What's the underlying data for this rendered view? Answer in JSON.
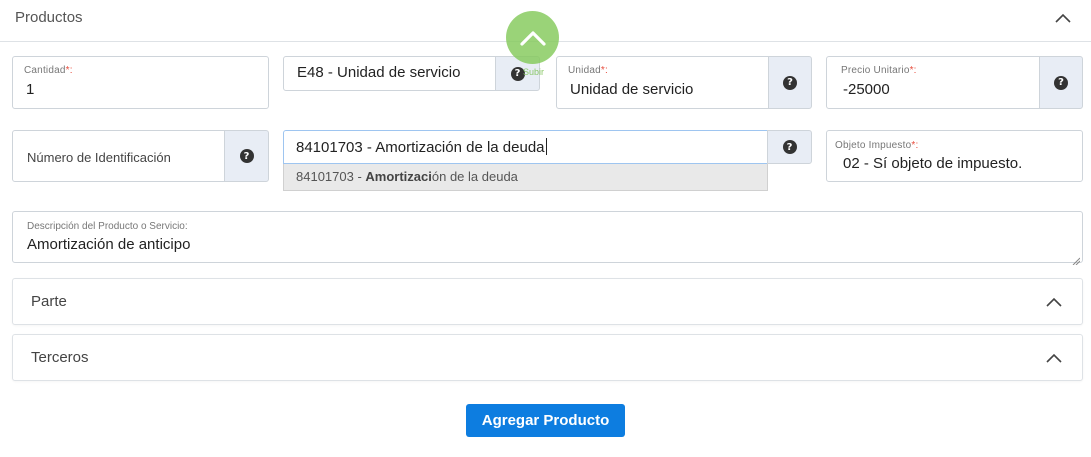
{
  "section": {
    "title": "Productos"
  },
  "fields": {
    "cantidad": {
      "label": "Cantidad",
      "required_mark": "*:",
      "value": "1"
    },
    "unidad_clave": {
      "value": "E48 - Unidad de servicio"
    },
    "unidad": {
      "label": "Unidad",
      "required_mark": "*:",
      "value": "Unidad de servicio"
    },
    "precio": {
      "label": "Precio Unitario",
      "required_mark": "*:",
      "value": "-25000"
    },
    "numero_identificacion": {
      "label": "Número de Identificación"
    },
    "clave_producto": {
      "value": "84101703 - Amortización de la deuda"
    },
    "objeto_impuesto": {
      "label": "Objeto Impuesto",
      "required_mark": "*:",
      "value": "02 - Sí objeto de impuesto."
    },
    "descripcion": {
      "label": "Descripción del Producto o Servicio:",
      "value": "Amortización de anticipo"
    }
  },
  "dropdown": {
    "prefix": "84101703 - ",
    "match": "Amortizaci",
    "suffix": "ón de la deuda"
  },
  "panels": {
    "parte": "Parte",
    "terceros": "Terceros"
  },
  "buttons": {
    "agregar": "Agregar Producto"
  },
  "scroll_top": {
    "label": "Subir"
  },
  "help_glyph": "?",
  "colors": {
    "primary": "#0d7de0",
    "scroll_top": "#84c95a",
    "addon_bg": "#e8edf5",
    "required": "#e74c3c"
  }
}
